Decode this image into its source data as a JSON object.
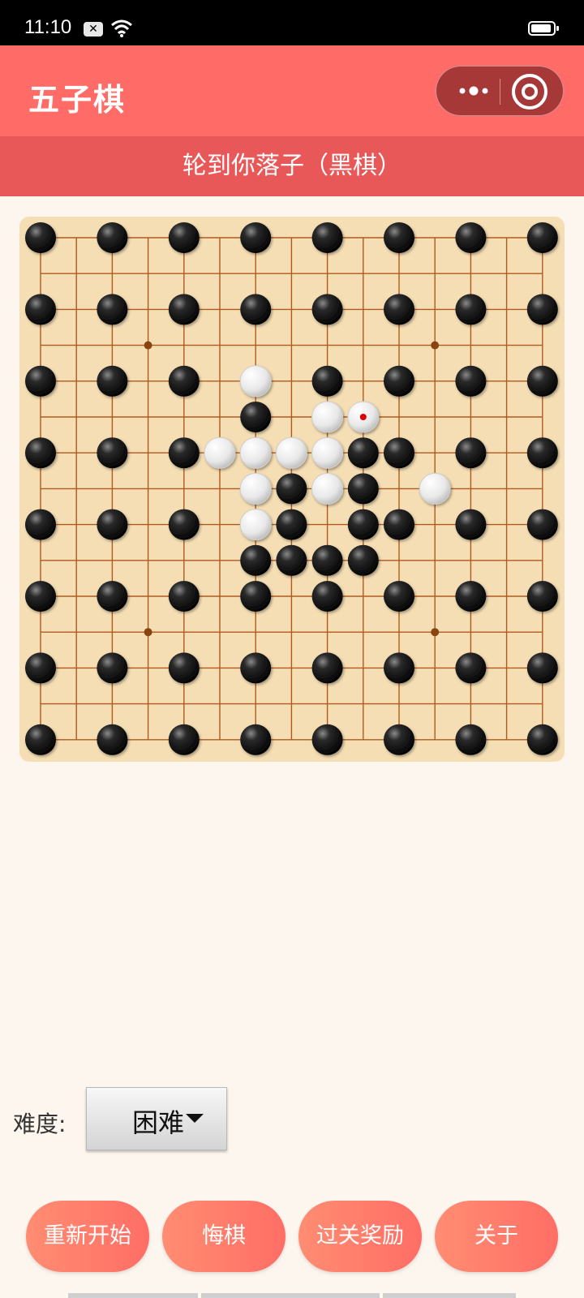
{
  "status_bar": {
    "time": "11:10",
    "icons": [
      "notification-x-icon",
      "wifi-icon",
      "battery-icon"
    ]
  },
  "title_bar": {
    "title": "五子棋",
    "capsule_icons": [
      "more-dots-icon",
      "close-target-icon"
    ],
    "color": "#ff6b66"
  },
  "turn_banner": {
    "text": "轮到你落子（黑棋）",
    "color": "#e85858"
  },
  "board": {
    "size": 15,
    "background": "#f5deb4",
    "line_color": "#b05a1e",
    "star_points": [
      [
        3,
        3
      ],
      [
        3,
        11
      ],
      [
        11,
        3
      ],
      [
        11,
        11
      ]
    ],
    "black_stones": [
      [
        0,
        0
      ],
      [
        0,
        2
      ],
      [
        0,
        4
      ],
      [
        0,
        6
      ],
      [
        0,
        8
      ],
      [
        0,
        10
      ],
      [
        0,
        12
      ],
      [
        0,
        14
      ],
      [
        2,
        0
      ],
      [
        2,
        2
      ],
      [
        2,
        4
      ],
      [
        2,
        6
      ],
      [
        2,
        8
      ],
      [
        2,
        10
      ],
      [
        2,
        12
      ],
      [
        2,
        14
      ],
      [
        4,
        0
      ],
      [
        4,
        2
      ],
      [
        4,
        4
      ],
      [
        4,
        8
      ],
      [
        4,
        10
      ],
      [
        4,
        12
      ],
      [
        4,
        14
      ],
      [
        5,
        6
      ],
      [
        6,
        0
      ],
      [
        6,
        2
      ],
      [
        6,
        4
      ],
      [
        6,
        9
      ],
      [
        6,
        10
      ],
      [
        6,
        12
      ],
      [
        6,
        14
      ],
      [
        7,
        7
      ],
      [
        7,
        9
      ],
      [
        8,
        0
      ],
      [
        8,
        2
      ],
      [
        8,
        4
      ],
      [
        8,
        7
      ],
      [
        8,
        9
      ],
      [
        8,
        10
      ],
      [
        8,
        12
      ],
      [
        8,
        14
      ],
      [
        9,
        6
      ],
      [
        9,
        7
      ],
      [
        9,
        8
      ],
      [
        9,
        9
      ],
      [
        10,
        0
      ],
      [
        10,
        2
      ],
      [
        10,
        4
      ],
      [
        10,
        6
      ],
      [
        10,
        8
      ],
      [
        10,
        10
      ],
      [
        10,
        12
      ],
      [
        10,
        14
      ],
      [
        12,
        0
      ],
      [
        12,
        2
      ],
      [
        12,
        4
      ],
      [
        12,
        6
      ],
      [
        12,
        8
      ],
      [
        12,
        10
      ],
      [
        12,
        12
      ],
      [
        12,
        14
      ],
      [
        14,
        0
      ],
      [
        14,
        2
      ],
      [
        14,
        4
      ],
      [
        14,
        6
      ],
      [
        14,
        8
      ],
      [
        14,
        10
      ],
      [
        14,
        12
      ],
      [
        14,
        14
      ]
    ],
    "white_stones": [
      [
        4,
        6
      ],
      [
        5,
        8
      ],
      [
        5,
        9
      ],
      [
        6,
        5
      ],
      [
        6,
        6
      ],
      [
        6,
        7
      ],
      [
        6,
        8
      ],
      [
        7,
        6
      ],
      [
        7,
        8
      ],
      [
        7,
        11
      ],
      [
        8,
        6
      ]
    ],
    "last_move": [
      5,
      9
    ],
    "last_move_marker_color": "#e00000"
  },
  "difficulty": {
    "label": "难度:",
    "selected": "困难"
  },
  "buttons": {
    "restart": "重新开始",
    "undo": "悔棋",
    "reward": "过关奖励",
    "about": "关于"
  }
}
